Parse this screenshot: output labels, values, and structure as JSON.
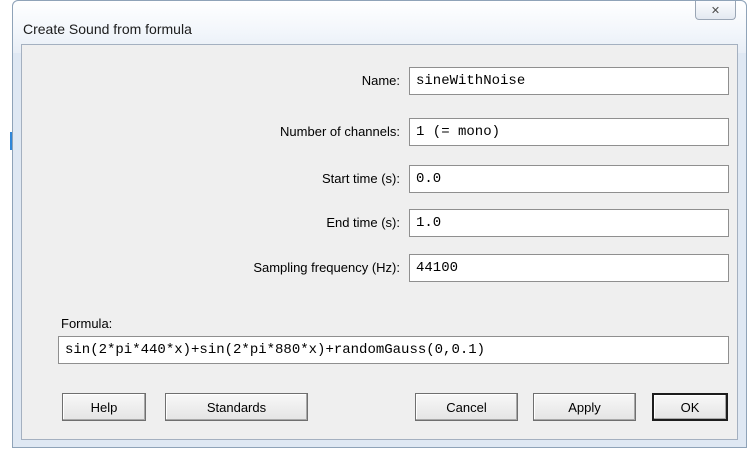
{
  "window": {
    "title": "Create Sound from formula"
  },
  "fields": [
    {
      "label": "Name:",
      "value": "sineWithNoise"
    },
    {
      "label": "Number of channels:",
      "value": "1 (= mono)"
    },
    {
      "label": "Start time (s):",
      "value": "0.0"
    },
    {
      "label": "End time (s):",
      "value": "1.0"
    },
    {
      "label": "Sampling frequency (Hz):",
      "value": "44100"
    }
  ],
  "formula": {
    "label": "Formula:",
    "value": "sin(2*pi*440*x)+sin(2*pi*880*x)+randomGauss(0,0.1)"
  },
  "buttons": {
    "help": "Help",
    "standards": "Standards",
    "cancel": "Cancel",
    "apply": "Apply",
    "ok": "OK"
  },
  "icons": {
    "close": "close-icon"
  }
}
